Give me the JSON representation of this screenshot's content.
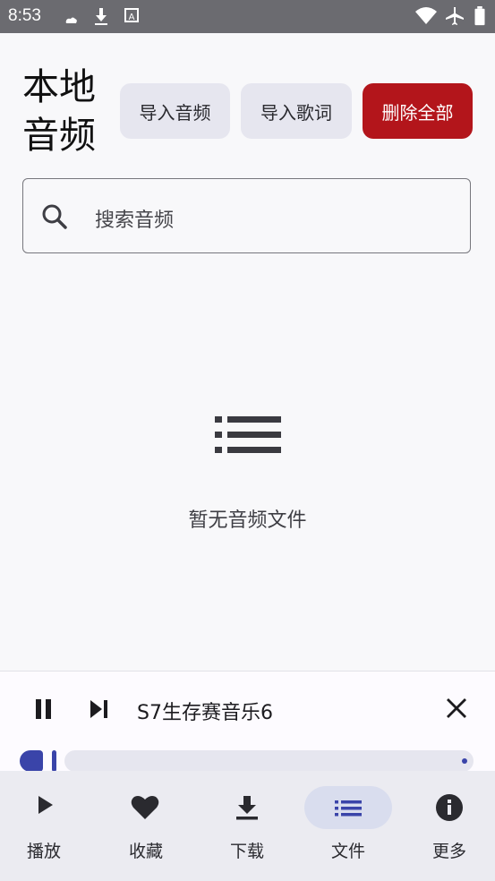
{
  "status_bar": {
    "time": "8:53"
  },
  "header": {
    "title": "本地音频",
    "import_audio_label": "导入音频",
    "import_lyrics_label": "导入歌词",
    "delete_all_label": "删除全部"
  },
  "search": {
    "placeholder": "搜索音频"
  },
  "empty_state": {
    "icon": "list-icon",
    "text": "暂无音频文件"
  },
  "player": {
    "track_title": "S7生存赛音乐6",
    "progress_fraction": 0.08
  },
  "nav": {
    "items": [
      {
        "label": "播放",
        "icon": "play-icon"
      },
      {
        "label": "收藏",
        "icon": "heart-icon"
      },
      {
        "label": "下载",
        "icon": "download-icon"
      },
      {
        "label": "文件",
        "icon": "list-icon"
      },
      {
        "label": "更多",
        "icon": "info-icon"
      }
    ],
    "active_index": 3
  },
  "colors": {
    "accent": "#3a44a9",
    "danger": "#b3151b",
    "status_bar": "#6b6b70"
  }
}
